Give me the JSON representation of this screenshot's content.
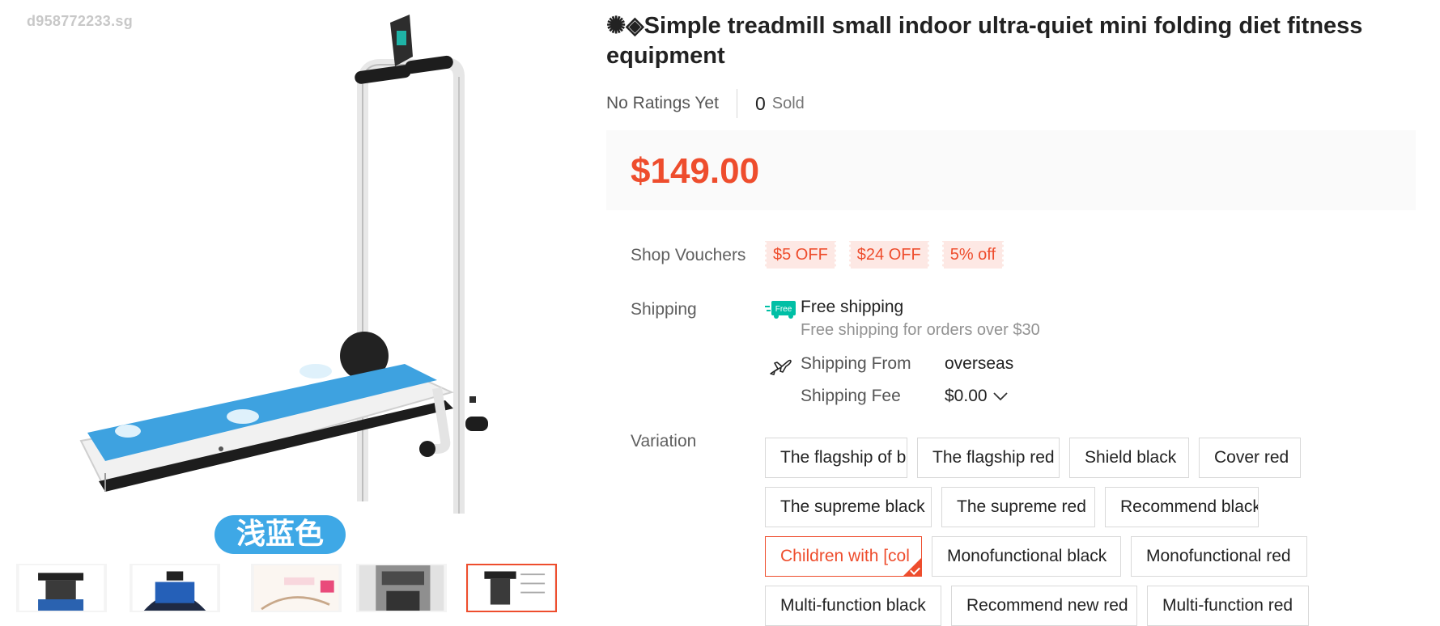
{
  "gallery": {
    "watermark": "d958772233.sg",
    "color_badge": "浅蓝色"
  },
  "product": {
    "title": "✺◈Simple treadmill small indoor ultra-quiet mini folding diet fitness equipment",
    "ratings": "No Ratings Yet",
    "sold_count": "0",
    "sold_label": "Sold",
    "price": "$149.00"
  },
  "vouchers": {
    "label": "Shop Vouchers",
    "items": [
      "$5 OFF",
      "$24 OFF",
      "5% off"
    ]
  },
  "shipping": {
    "label": "Shipping",
    "free_icon_text": "Free",
    "free_title": "Free shipping",
    "free_subtitle": "Free shipping for orders over $30",
    "from_label": "Shipping From",
    "from_value": "overseas",
    "fee_label": "Shipping Fee",
    "fee_value": "$0.00"
  },
  "variation": {
    "label": "Variation",
    "options": [
      "The flagship of bl",
      "The flagship red",
      "Shield black",
      "Cover red",
      "The supreme black",
      "The supreme red",
      "Recommend black",
      "Children with [col",
      "Monofunctional black",
      "Monofunctional red",
      "Multi-function black",
      "Recommend new red",
      "Multi-function red"
    ],
    "selected": "Children with [col"
  },
  "colors": {
    "accent": "#ee4d2d",
    "price_bg": "#fafafa",
    "voucher_bg": "#fde8e4",
    "free_icon": "#00bfa5"
  }
}
